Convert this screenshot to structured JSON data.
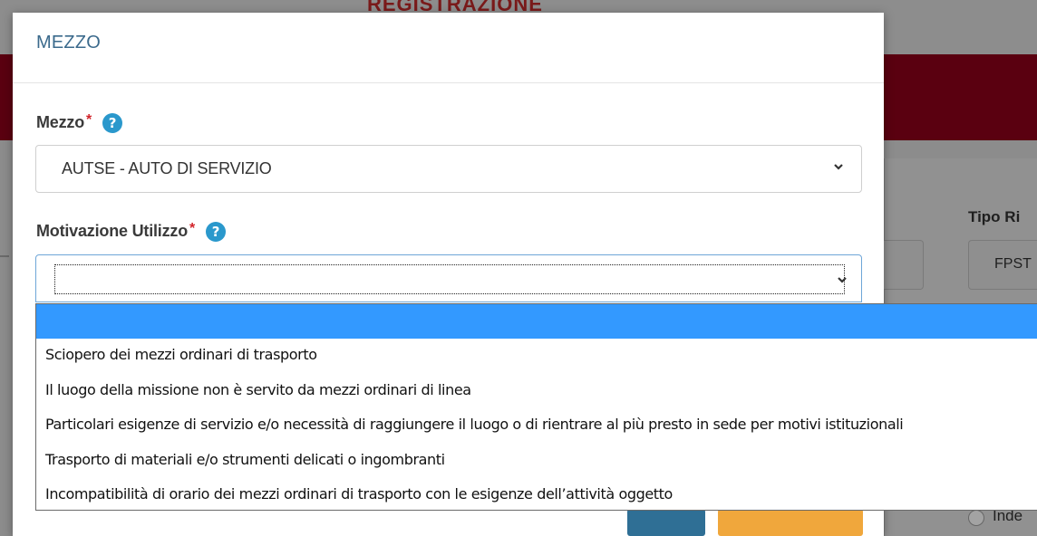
{
  "background": {
    "heading": "REGISTRAZIONE",
    "tipo_label": "Tipo Ri",
    "tipo_value": "FPST",
    "radio_label": "Inde"
  },
  "modal": {
    "title": "MEZZO",
    "mezzo": {
      "label": "Mezzo",
      "required_mark": "*",
      "help": "?",
      "value": "AUTSE - AUTO DI SERVIZIO"
    },
    "motivazione": {
      "label": "Motivazione Utilizzo",
      "required_mark": "*",
      "help": "?",
      "value": ""
    }
  },
  "dropdown": {
    "options": [
      "",
      "Sciopero dei mezzi ordinari di trasporto",
      "Il luogo della missione non è servito da mezzi ordinari di linea",
      "Particolari esigenze di servizio e/o necessità di raggiungere il luogo o di rientrare al più presto in sede per motivi istituzionali",
      "Trasporto di materiali e/o strumenti delicati o ingombranti",
      "Incompatibilità di orario dei mezzi ordinari di trasporto con le esigenze dell’attività oggetto"
    ],
    "selected_index": 0
  },
  "colors": {
    "accent_blue": "#3399ff",
    "title_blue": "#3b6a8c",
    "required_red": "#d2232a",
    "help_blue": "#2a98cc"
  },
  "icons": {
    "chevron": "chevron-down-icon",
    "help": "help-circle-icon",
    "radio": "radio-button-icon"
  }
}
